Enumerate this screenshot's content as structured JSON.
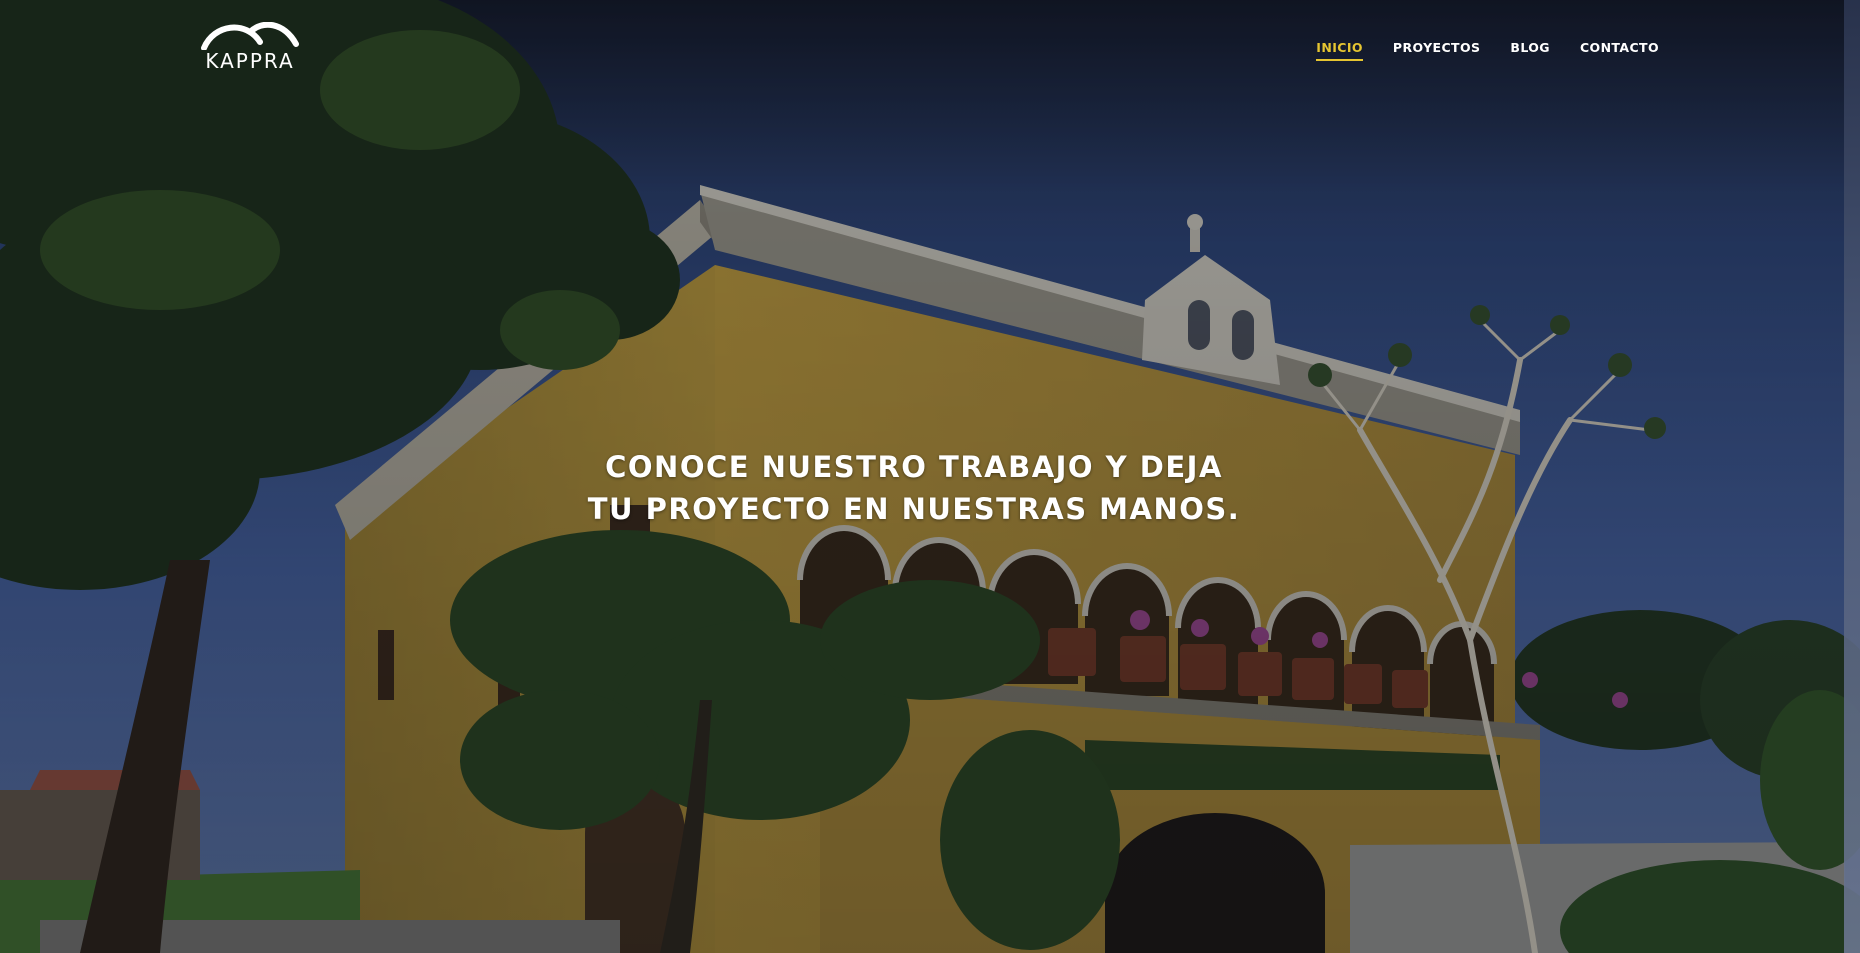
{
  "brand": {
    "name": "KAPPRA"
  },
  "nav": {
    "items": [
      {
        "label": "INICIO",
        "active": true
      },
      {
        "label": "PROYECTOS",
        "active": false
      },
      {
        "label": "BLOG",
        "active": false
      },
      {
        "label": "CONTACTO",
        "active": false
      }
    ]
  },
  "hero": {
    "headline_line1": "CONOCE NUESTRO TRABAJO Y DEJA",
    "headline_line2": "TU PROYECTO EN NUESTRAS MANOS."
  },
  "colors": {
    "accent": "#e6c531",
    "text": "#ffffff",
    "sky": "#3d5a99",
    "facade": "#c9a53c"
  }
}
